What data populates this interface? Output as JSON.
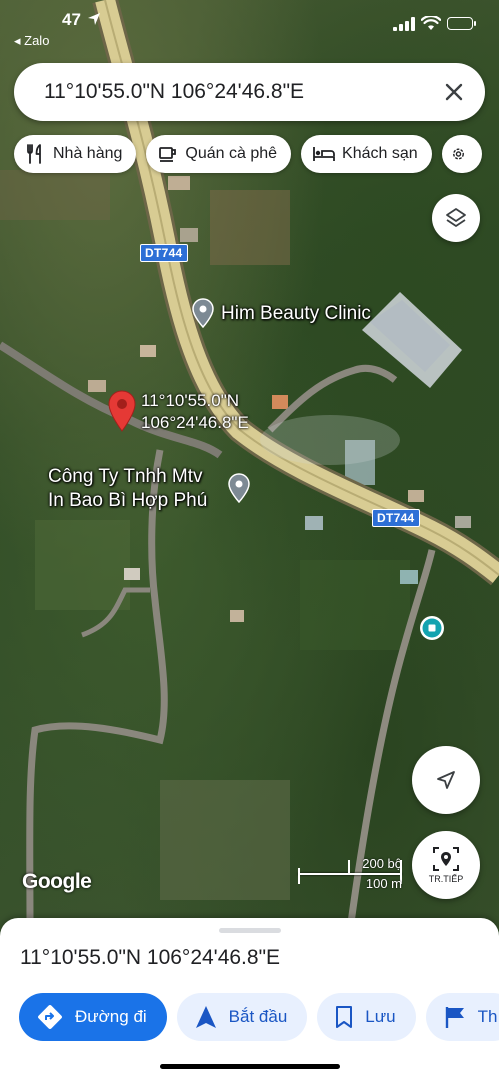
{
  "status_bar": {
    "time": "47",
    "back_app": "◂ Zalo"
  },
  "search": {
    "value": "11°10'55.0\"N 106°24'46.8\"E"
  },
  "chips": [
    {
      "label": "Nhà hàng",
      "icon": "restaurant-icon"
    },
    {
      "label": "Quán cà phê",
      "icon": "coffee-icon"
    },
    {
      "label": "Khách sạn",
      "icon": "hotel-icon"
    }
  ],
  "map": {
    "road_labels": [
      "DT744",
      "DT744"
    ],
    "pin_coord_line1": "11°10'55.0\"N",
    "pin_coord_line2": "106°24'46.8\"E",
    "poi": [
      {
        "name": "Him Beauty Clinic"
      },
      {
        "name_line1": "Công Ty Tnhh Mtv",
        "name_line2": "In Bao Bì Hợp Phú"
      }
    ],
    "brand": "Google",
    "scale_top": "200 bộ",
    "scale_bottom": "100 m",
    "nav_label": "TR.TIẾP"
  },
  "sheet": {
    "title": "11°10'55.0\"N 106°24'46.8\"E",
    "actions": [
      {
        "label": "Đường đi",
        "icon": "directions-icon"
      },
      {
        "label": "Bắt đầu",
        "icon": "navigation-arrow-icon"
      },
      {
        "label": "Lưu",
        "icon": "bookmark-icon"
      },
      {
        "label": "Th",
        "icon": "flag-icon"
      }
    ]
  },
  "colors": {
    "accent": "#1a73e8",
    "pin": "#e53935",
    "road_label": "#2d6fd6"
  }
}
